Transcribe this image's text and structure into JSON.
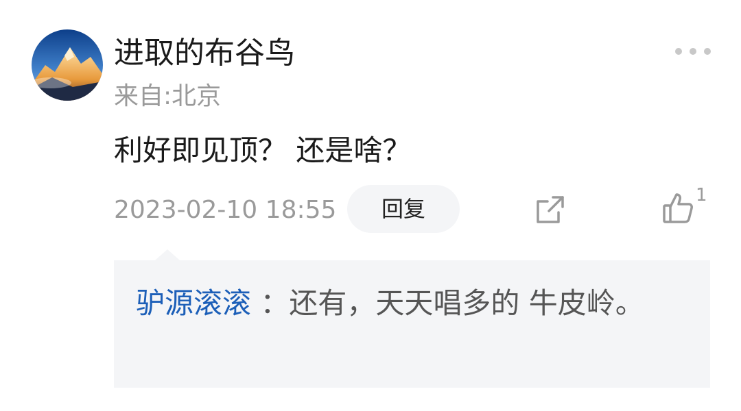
{
  "comment": {
    "username": "进取的布谷鸟",
    "location": "来自:北京",
    "text": "利好即见顶？ 还是啥？",
    "timestamp": "2023-02-10 18:55",
    "reply_label": "回复",
    "like_count": "1"
  },
  "sub_reply": {
    "author": "驴源滚滚",
    "separator": " ：",
    "text": "还有，天天唱多的  牛皮岭。"
  },
  "colors": {
    "author_link": "#1c5fb8",
    "reply_bg": "#f4f5f7"
  },
  "icons": {
    "more": "more-dots-icon",
    "share": "share-icon",
    "like": "thumbs-up-icon"
  }
}
